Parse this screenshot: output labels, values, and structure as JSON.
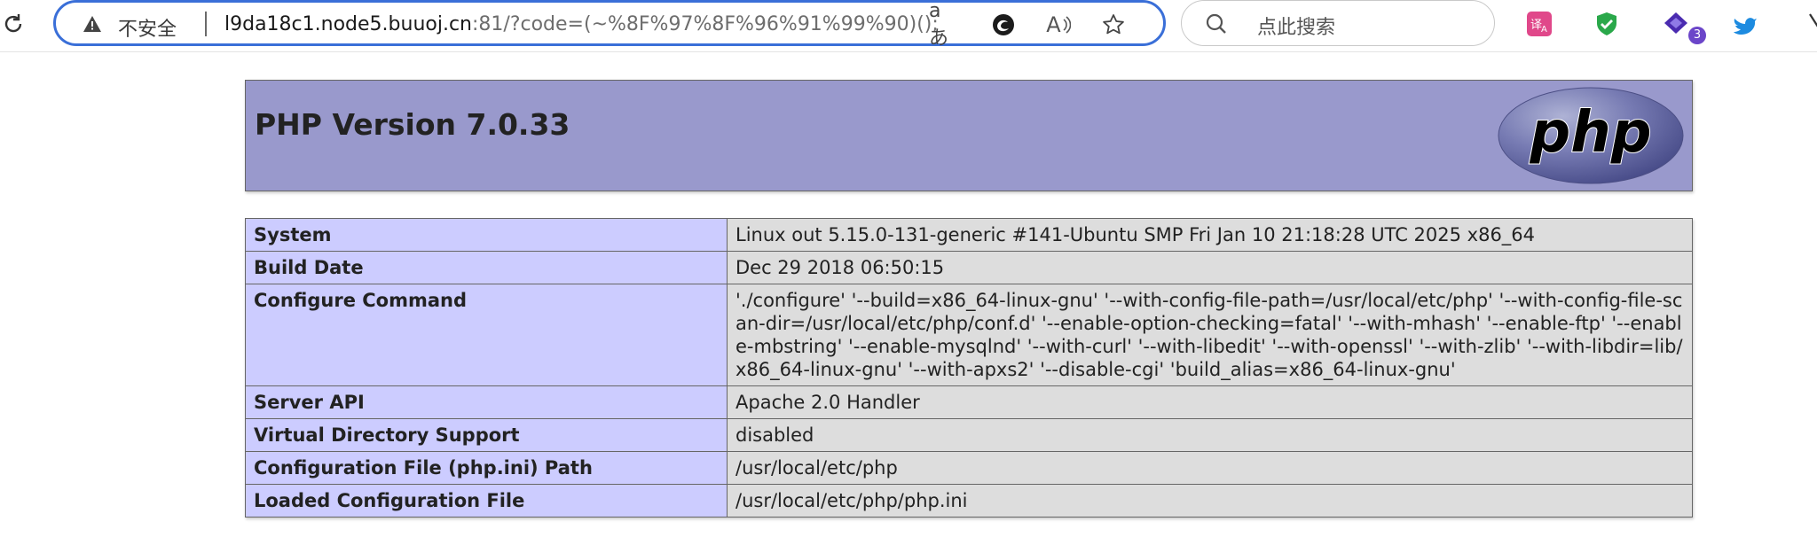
{
  "browser": {
    "security_label": "不安全",
    "url_host": "l9da18c1.node5.buuoj.cn",
    "url_rest": ":81/?code=(~%8F%97%8F%96%91%99%90)();",
    "search_placeholder": "点此搜索",
    "extension_badge": "3",
    "read_aloud_glyph": "A",
    "translate_glyph": "aあ"
  },
  "phpinfo": {
    "title": "PHP Version 7.0.33",
    "logo_text": "php",
    "rows": [
      {
        "key": "System",
        "value": "Linux out 5.15.0-131-generic #141-Ubuntu SMP Fri Jan 10 21:18:28 UTC 2025 x86_64"
      },
      {
        "key": "Build Date",
        "value": "Dec 29 2018 06:50:15"
      },
      {
        "key": "Configure Command",
        "value": "'./configure' '--build=x86_64-linux-gnu' '--with-config-file-path=/usr/local/etc/php' '--with-config-file-scan-dir=/usr/local/etc/php/conf.d' '--enable-option-checking=fatal' '--with-mhash' '--enable-ftp' '--enable-mbstring' '--enable-mysqlnd' '--with-curl' '--with-libedit' '--with-openssl' '--with-zlib' '--with-libdir=lib/x86_64-linux-gnu' '--with-apxs2' '--disable-cgi' 'build_alias=x86_64-linux-gnu'"
      },
      {
        "key": "Server API",
        "value": "Apache 2.0 Handler"
      },
      {
        "key": "Virtual Directory Support",
        "value": "disabled"
      },
      {
        "key": "Configuration File (php.ini) Path",
        "value": "/usr/local/etc/php"
      },
      {
        "key": "Loaded Configuration File",
        "value": "/usr/local/etc/php/php.ini"
      }
    ]
  },
  "colors": {
    "header_bg": "#9999cc",
    "key_bg": "#ccccff",
    "value_bg": "#dddddd",
    "address_border": "#3a6fd8"
  }
}
